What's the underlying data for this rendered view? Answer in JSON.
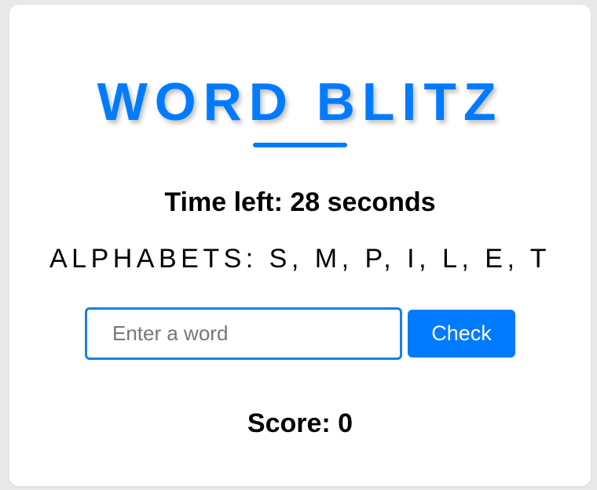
{
  "game": {
    "title": "WORD BLITZ",
    "timer_text": "Time left: 28 seconds",
    "alphabets_text": "ALPHABETS: S, M, P, I, L, E, T",
    "input": {
      "value": "",
      "placeholder": "Enter a word"
    },
    "check_label": "Check",
    "score_text": "Score: 0"
  },
  "colors": {
    "accent": "#007bff",
    "input_border": "#1a7fe6",
    "card": "#ffffff",
    "page_background": "#e9e9e9"
  }
}
